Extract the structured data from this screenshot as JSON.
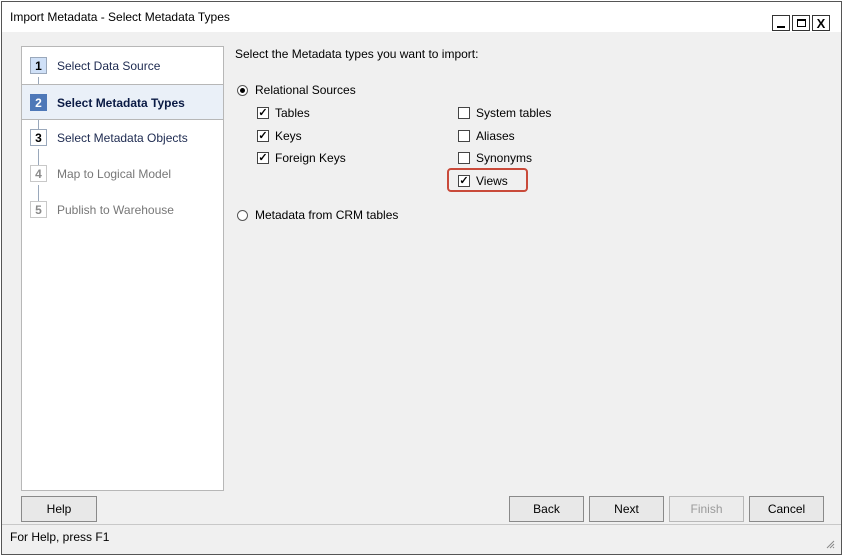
{
  "window": {
    "title": "Import Metadata - Select Metadata Types",
    "minimize_label": "",
    "maximize_label": "",
    "close_label": "X"
  },
  "wizard_steps": [
    {
      "number": "1",
      "label": "Select Data Source",
      "state": "done"
    },
    {
      "number": "2",
      "label": "Select Metadata Types",
      "state": "active"
    },
    {
      "number": "3",
      "label": "Select Metadata Objects",
      "state": "next"
    },
    {
      "number": "4",
      "label": "Map to Logical Model",
      "state": "disabled"
    },
    {
      "number": "5",
      "label": "Publish to Warehouse",
      "state": "disabled"
    }
  ],
  "main": {
    "prompt": "Select the Metadata types you want to import:",
    "relational_sources": {
      "label": "Relational Sources",
      "selected": true
    },
    "crm_tables": {
      "label": "Metadata from CRM tables",
      "selected": false
    },
    "checkboxes_left": [
      {
        "label": "Tables",
        "checked": true
      },
      {
        "label": "Keys",
        "checked": true
      },
      {
        "label": "Foreign Keys",
        "checked": true
      }
    ],
    "checkboxes_right": [
      {
        "label": "System tables",
        "checked": false
      },
      {
        "label": "Aliases",
        "checked": false
      },
      {
        "label": "Synonyms",
        "checked": false
      },
      {
        "label": "Views",
        "checked": true
      }
    ],
    "check_mark": "✓"
  },
  "buttons": {
    "help": "Help",
    "back": "Back",
    "next": "Next",
    "finish": "Finish",
    "cancel": "Cancel"
  },
  "status_bar": {
    "text": "For Help, press F1"
  },
  "colors": {
    "highlight": "#c94a3a",
    "active_step": "#4e78b8"
  }
}
